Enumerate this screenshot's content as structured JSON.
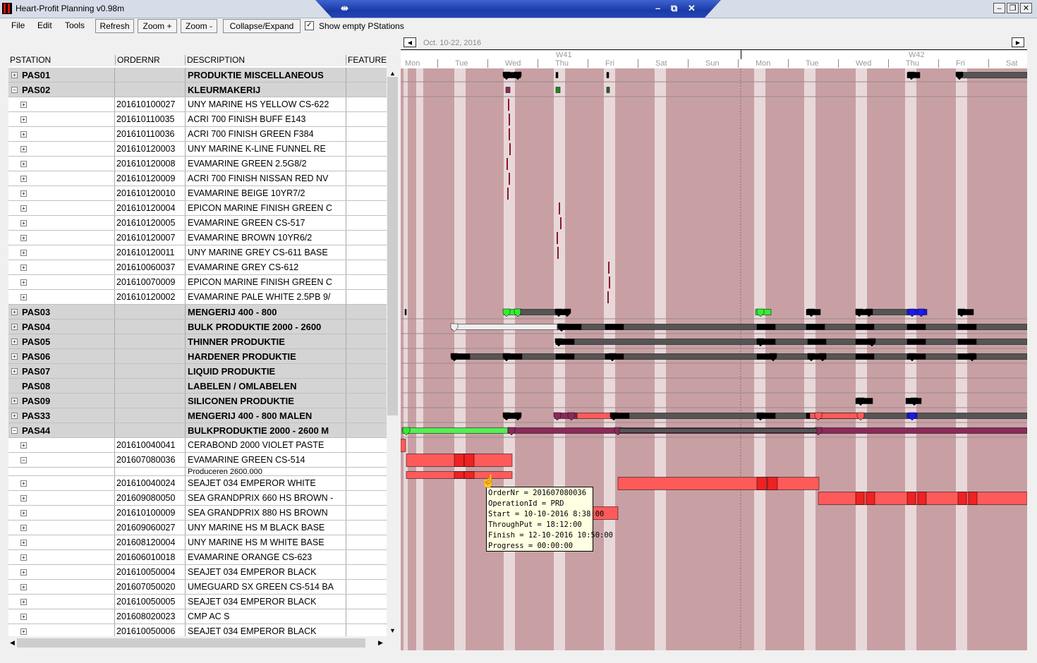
{
  "window": {
    "title": "Heart-Profit Planning v0.98m"
  },
  "menu": [
    "File",
    "Edit",
    "Tools"
  ],
  "toolbar": {
    "refresh": "Refresh",
    "zoom_in": "Zoom +",
    "zoom_out": "Zoom -",
    "collapse_expand": "Collapse/Expand",
    "show_empty_checked": true,
    "show_empty_label": "Show empty PStations"
  },
  "grid": {
    "headers": [
      "PSTATION",
      "ORDERNR",
      "DESCRIPTION",
      "FEATURE"
    ],
    "rows": [
      {
        "type": "ps",
        "exp": "+",
        "code": "PAS01",
        "order": "",
        "desc": "PRODUKTIE MISCELLANEOUS"
      },
      {
        "type": "ps",
        "exp": "−",
        "code": "PAS02",
        "order": "",
        "desc": "KLEURMAKERIJ"
      },
      {
        "type": "sub",
        "exp": "+",
        "code": "",
        "order": "201610100027",
        "desc": "UNY MARINE HS YELLOW CS-622"
      },
      {
        "type": "sub",
        "exp": "+",
        "code": "",
        "order": "201610110035",
        "desc": "ACRI 700 FINISH BUFF E143"
      },
      {
        "type": "sub",
        "exp": "+",
        "code": "",
        "order": "201610110036",
        "desc": "ACRI 700 FINISH GREEN F384"
      },
      {
        "type": "sub",
        "exp": "+",
        "code": "",
        "order": "201610120003",
        "desc": "UNY MARINE  K-LINE FUNNEL RE"
      },
      {
        "type": "sub",
        "exp": "+",
        "code": "",
        "order": "201610120008",
        "desc": "EVAMARINE GREEN 2.5G8/2"
      },
      {
        "type": "sub",
        "exp": "+",
        "code": "",
        "order": "201610120009",
        "desc": "ACRI 700 FINISH NISSAN RED NV"
      },
      {
        "type": "sub",
        "exp": "+",
        "code": "",
        "order": "201610120010",
        "desc": "EVAMARINE BEIGE 10YR7/2"
      },
      {
        "type": "sub",
        "exp": "+",
        "code": "",
        "order": "201610120004",
        "desc": "EPICON MARINE FINISH GREEN C"
      },
      {
        "type": "sub",
        "exp": "+",
        "code": "",
        "order": "201610120005",
        "desc": "EVAMARINE GREEN CS-517"
      },
      {
        "type": "sub",
        "exp": "+",
        "code": "",
        "order": "201610120007",
        "desc": "EVAMARINE BROWN 10YR6/2"
      },
      {
        "type": "sub",
        "exp": "+",
        "code": "",
        "order": "201610120011",
        "desc": "UNY MARINE GREY CS-611 BASE"
      },
      {
        "type": "sub",
        "exp": "+",
        "code": "",
        "order": "201610060037",
        "desc": "EVAMARINE GREY CS-612"
      },
      {
        "type": "sub",
        "exp": "+",
        "code": "",
        "order": "201610070009",
        "desc": "EPICON MARINE FINISH GREEN C"
      },
      {
        "type": "sub",
        "exp": "+",
        "code": "",
        "order": "201610120002",
        "desc": "EVAMARINE PALE WHITE 2.5PB 9/"
      },
      {
        "type": "ps",
        "exp": "+",
        "code": "PAS03",
        "order": "",
        "desc": "MENGERIJ 400 - 800"
      },
      {
        "type": "ps",
        "exp": "+",
        "code": "PAS04",
        "order": "",
        "desc": "BULK PRODUKTIE 2000 - 2600"
      },
      {
        "type": "ps",
        "exp": "+",
        "code": "PAS05",
        "order": "",
        "desc": "THINNER PRODUKTIE"
      },
      {
        "type": "ps",
        "exp": "+",
        "code": "PAS06",
        "order": "",
        "desc": "HARDENER PRODUKTIE"
      },
      {
        "type": "ps",
        "exp": "+",
        "code": "PAS07",
        "order": "",
        "desc": "LIQUID PRODUKTIE"
      },
      {
        "type": "ps",
        "exp": "",
        "code": "PAS08",
        "order": "",
        "desc": "LABELEN / OMLABELEN"
      },
      {
        "type": "ps",
        "exp": "+",
        "code": "PAS09",
        "order": "",
        "desc": "SILICONEN PRODUKTIE"
      },
      {
        "type": "ps",
        "exp": "+",
        "code": "PAS33",
        "order": "",
        "desc": "MENGERIJ 400 - 800 MALEN"
      },
      {
        "type": "ps",
        "exp": "−",
        "code": "PAS44",
        "order": "",
        "desc": "BULKPRODUKTIE 2000 - 2600 M"
      },
      {
        "type": "sub",
        "exp": "+",
        "code": "",
        "order": "201610040041",
        "desc": "CERABOND 2000 VIOLET PASTE"
      },
      {
        "type": "sub",
        "exp": "−",
        "code": "",
        "order": "201607080036",
        "desc": "EVAMARINE GREEN CS-514"
      },
      {
        "type": "op",
        "exp": "",
        "code": "",
        "order": "",
        "desc": "Produceren 2600.000"
      },
      {
        "type": "sub",
        "exp": "+",
        "code": "",
        "order": "201610040024",
        "desc": "SEAJET 034 EMPEROR WHITE"
      },
      {
        "type": "sub",
        "exp": "+",
        "code": "",
        "order": "201609080050",
        "desc": "SEA GRANDPRIX 660 HS BROWN -"
      },
      {
        "type": "sub",
        "exp": "+",
        "code": "",
        "order": "201610100009",
        "desc": "SEA GRANDPRIX 880 HS BROWN"
      },
      {
        "type": "sub",
        "exp": "+",
        "code": "",
        "order": "201609060027",
        "desc": "UNY MARINE HS M BLACK BASE"
      },
      {
        "type": "sub",
        "exp": "+",
        "code": "",
        "order": "201608120004",
        "desc": "UNY MARINE HS M WHITE BASE"
      },
      {
        "type": "sub",
        "exp": "+",
        "code": "",
        "order": "201606010018",
        "desc": "EVAMARINE ORANGE CS-623"
      },
      {
        "type": "sub",
        "exp": "+",
        "code": "",
        "order": "201610050004",
        "desc": "SEAJET 034 EMPEROR BLACK"
      },
      {
        "type": "sub",
        "exp": "+",
        "code": "",
        "order": "201607050020",
        "desc": "UMEGUARD SX GREEN CS-514 BA"
      },
      {
        "type": "sub",
        "exp": "+",
        "code": "",
        "order": "201610050005",
        "desc": "SEAJET 034 EMPEROR BLACK"
      },
      {
        "type": "sub",
        "exp": "+",
        "code": "",
        "order": "201608020023",
        "desc": "CMP AC S"
      },
      {
        "type": "sub",
        "exp": "+",
        "code": "",
        "order": "201610050006",
        "desc": "SEAJET 034 EMPEROR BLACK"
      }
    ]
  },
  "gantt": {
    "date_range": "Oct. 10-22, 2016",
    "weeks": [
      "W41",
      "W42"
    ],
    "days": [
      "Mon",
      "Tue",
      "Wed",
      "Thu",
      "Fri",
      "Sat",
      "Sun",
      "Mon",
      "Tue",
      "Wed",
      "Thu",
      "Fri",
      "Sat"
    ],
    "colors": {
      "background": "#c8a0a4",
      "stripe": "#e8d8da",
      "black": "#000000",
      "grey": "#555555",
      "red": "#ff5a5a",
      "green": "#33ee33",
      "blue": "#1a1aee",
      "purple": "#8a2a5a",
      "light": "#eeeeee"
    }
  },
  "tooltip": {
    "lines": [
      "OrderNr = 201607080036",
      "OperationId = PRD",
      "Start = 10-10-2016 8:38:00",
      "ThroughPut = 18:12:00",
      "Finish = 12-10-2016 10:50:00",
      "Progress = 00:00:00"
    ]
  }
}
